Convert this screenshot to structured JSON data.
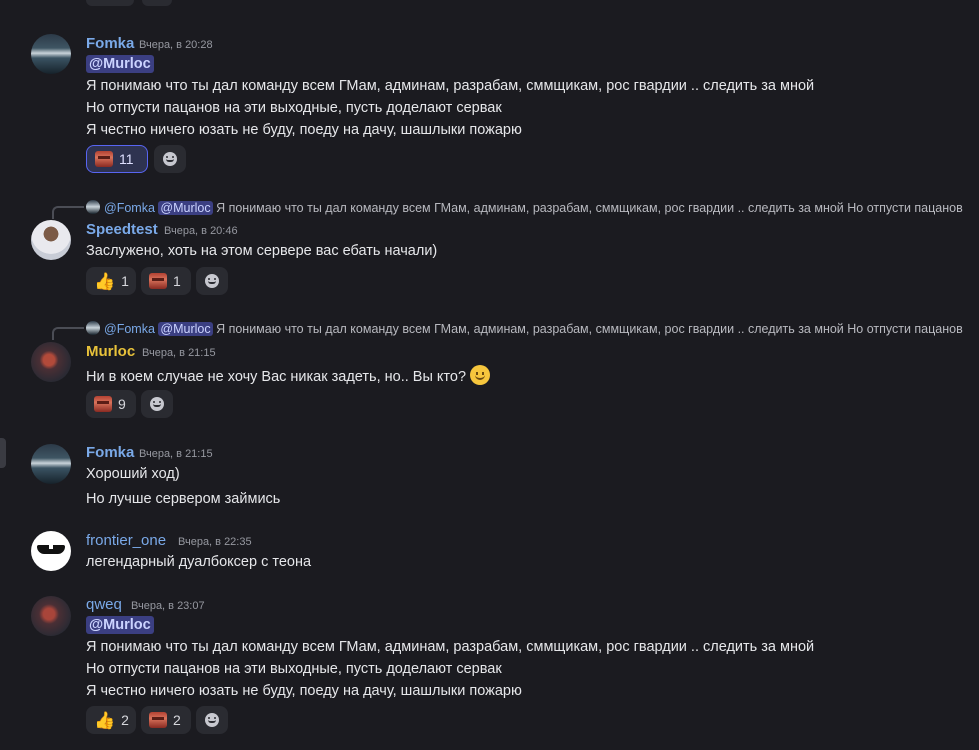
{
  "messages": [
    {
      "author": "Fomka",
      "time": "Вчера, в 20:28",
      "mention": "@Murloc",
      "lines": [
        "Я понимаю что ты дал команду всем ГМам, админам, разрабам, сммщикам, рос гвардии .. следить за мной",
        "Но отпусти пацанов на эти выходные, пусть доделают сервак",
        "Я честно ничего юзать не буду, поеду на дачу, шашлыки пожарю"
      ],
      "reactions": [
        {
          "icon": "facepalm-emoji",
          "count": "11",
          "active": true
        }
      ]
    },
    {
      "reply": {
        "author": "@Fomka",
        "mention": "@Murloc",
        "text": "Я понимаю что ты дал команду всем ГМам, админам, разрабам, сммщикам, рос гвардии .. следить за мной Но отпусти пацанов"
      },
      "author": "Speedtest",
      "time": "Вчера, в 20:46",
      "lines": [
        "Заслужено, хоть на этом сервере вас ебать начали)"
      ],
      "reactions": [
        {
          "icon": "thumbs-up-emoji",
          "count": "1"
        },
        {
          "icon": "facepalm-emoji",
          "count": "1"
        }
      ]
    },
    {
      "reply": {
        "author": "@Fomka",
        "mention": "@Murloc",
        "text": "Я понимаю что ты дал команду всем ГМам, админам, разрабам, сммщикам, рос гвардии .. следить за мной Но отпусти пацанов"
      },
      "author": "Murloc",
      "time": "Вчера, в 21:15",
      "lines": [
        "Ни в коем случае не хочу Вас никак задеть, но.. Вы кто?"
      ],
      "reactions": [
        {
          "icon": "facepalm-emoji",
          "count": "9"
        }
      ]
    },
    {
      "author": "Fomka",
      "time": "Вчера, в 21:15",
      "lines": [
        "Хороший ход)",
        "Но лучше сервером займись"
      ]
    },
    {
      "author": "frontier_one",
      "time": "Вчера, в 22:35",
      "lines": [
        "легендарный дуалбоксер с теона"
      ]
    },
    {
      "author": "qweq",
      "time": "Вчера, в 23:07",
      "mention": "@Murloc",
      "lines": [
        "Я понимаю что ты дал команду всем ГМам, админам, разрабам, сммщикам, рос гвардии .. следить за мной",
        "Но отпусти пацанов на эти выходные, пусть доделают сервак",
        "Я честно ничего юзать не буду, поеду на дачу, шашлыки пожарю"
      ],
      "reactions": [
        {
          "icon": "thumbs-up-emoji",
          "count": "2"
        },
        {
          "icon": "facepalm-emoji",
          "count": "2"
        }
      ]
    }
  ],
  "colors": {
    "background": "#1b1b20",
    "username_blue": "#7aa9e8",
    "username_yellow": "#e8c23a",
    "mention_bg": "#3b3f82"
  }
}
